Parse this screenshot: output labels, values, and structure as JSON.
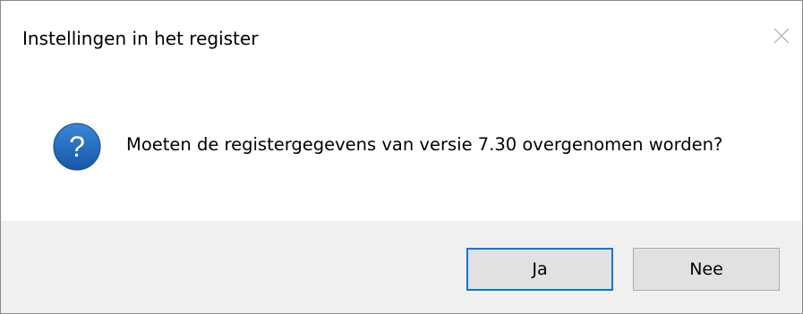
{
  "dialog": {
    "title": "Instellingen in het register",
    "message": "Moeten de registergegevens van versie 7.30 overgenomen worden?",
    "icon": "question-icon",
    "buttons": {
      "yes_label": "Ja",
      "no_label": "Nee"
    }
  },
  "colors": {
    "icon_blue": "#1c64b4",
    "default_button_border": "#0078d7",
    "footer_background": "#f0f0f0",
    "button_background": "#e1e1e1"
  }
}
